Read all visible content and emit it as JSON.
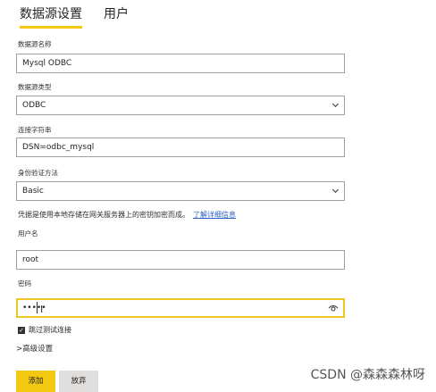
{
  "tabs": [
    {
      "label": "数据源设置",
      "active": true
    },
    {
      "label": "用户",
      "active": false
    }
  ],
  "fields": {
    "datasource_name": {
      "label": "数据源名称",
      "value": "Mysql ODBC"
    },
    "datasource_type": {
      "label": "数据源类型",
      "value": "ODBC"
    },
    "connection_string": {
      "label": "连接字符串",
      "value": "DSN=odbc_mysql"
    },
    "auth_method": {
      "label": "身份验证方法",
      "value": "Basic"
    },
    "username": {
      "label": "用户名",
      "value": "root"
    },
    "password": {
      "label": "密码",
      "value": "•••••"
    }
  },
  "info": {
    "text": "凭据是使用本地存储在网关服务器上的密钥加密而成。",
    "link": "了解详细信息"
  },
  "skip_test": {
    "label": "跳过测试连接",
    "checked": true
  },
  "advanced": {
    "label": "高级设置"
  },
  "buttons": {
    "add": "添加",
    "discard": "放弃"
  },
  "watermark": "CSDN @森森森林呀",
  "colors": {
    "accent": "#f2c811",
    "link": "#2b63c6"
  }
}
